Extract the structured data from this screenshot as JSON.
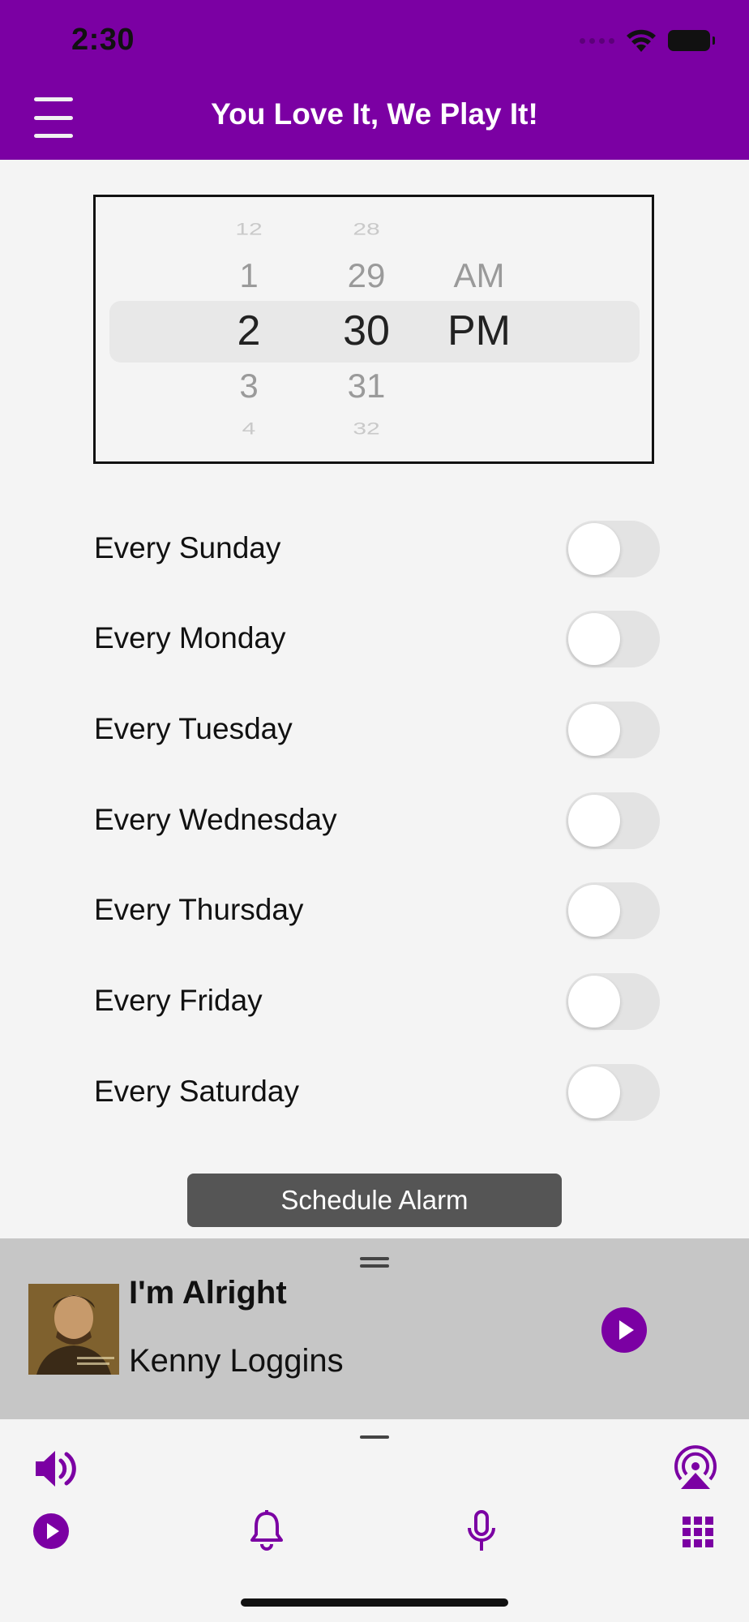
{
  "status_bar": {
    "time": "2:30"
  },
  "header": {
    "title": "You Love It, We Play It!"
  },
  "picker": {
    "hours": {
      "far_above": "12",
      "above": "1",
      "selected": "2",
      "below": "3",
      "far_below": "4"
    },
    "minutes": {
      "far_above": "28",
      "above": "29",
      "selected": "30",
      "below": "31",
      "far_below": "32"
    },
    "period": {
      "above": "AM",
      "selected": "PM"
    }
  },
  "days": [
    {
      "label": "Every Sunday",
      "enabled": false
    },
    {
      "label": "Every Monday",
      "enabled": false
    },
    {
      "label": "Every Tuesday",
      "enabled": false
    },
    {
      "label": "Every Wednesday",
      "enabled": false
    },
    {
      "label": "Every Thursday",
      "enabled": false
    },
    {
      "label": "Every Friday",
      "enabled": false
    },
    {
      "label": "Every Saturday",
      "enabled": false
    }
  ],
  "schedule_button": {
    "label": "Schedule Alarm"
  },
  "now_playing": {
    "title": "I'm Alright",
    "artist": "Kenny Loggins"
  },
  "icons": {
    "menu": "hamburger-menu-icon",
    "volume": "speaker-icon",
    "airplay": "airplay-icon",
    "play": "play-icon",
    "alarm": "bell-icon",
    "mic": "microphone-icon",
    "grid": "grid-icon"
  },
  "colors": {
    "brand": "#7b00a3",
    "button": "#555555",
    "player_bg": "#c6c6c6"
  }
}
